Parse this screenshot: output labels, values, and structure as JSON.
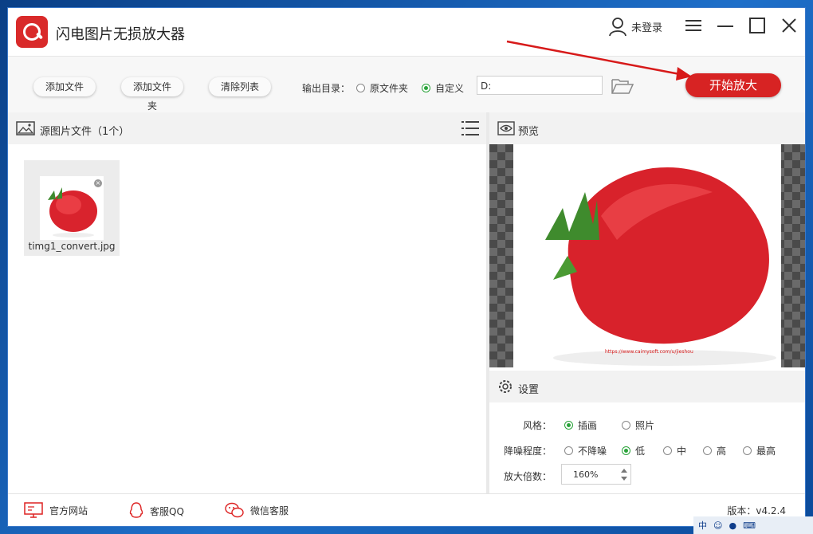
{
  "app": {
    "title": "闪电图片无损放大器",
    "user_label": "未登录"
  },
  "toolbar": {
    "add_file": "添加文件",
    "add_folder": "添加文件夹",
    "clear_list": "清除列表",
    "output_label": "输出目录：",
    "opt_original": "原文件夹",
    "opt_custom": "自定义",
    "selected_output": "自定义",
    "path_value": "D:",
    "start_label": "开始放大",
    "start_color": "#d72323"
  },
  "source": {
    "title": "源图片文件（1个）",
    "files": [
      {
        "name": "timg1_convert.jpg"
      }
    ]
  },
  "preview": {
    "title": "预览",
    "watermark": "https://www.caimysoft.com/u/jieshou"
  },
  "settings": {
    "title": "设置",
    "style_label": "风格：",
    "style_options": [
      "插画",
      "照片"
    ],
    "style_selected": "插画",
    "noise_label": "降噪程度：",
    "noise_options": [
      "不降噪",
      "低",
      "中",
      "高",
      "最高"
    ],
    "noise_selected": "低",
    "scale_label": "放大倍数：",
    "scale_value": "160%"
  },
  "footer": {
    "website": "官方网站",
    "qq": "客服QQ",
    "wechat": "微信客服",
    "version": "版本：v4.2.4"
  },
  "tray": {
    "ime": "中"
  }
}
